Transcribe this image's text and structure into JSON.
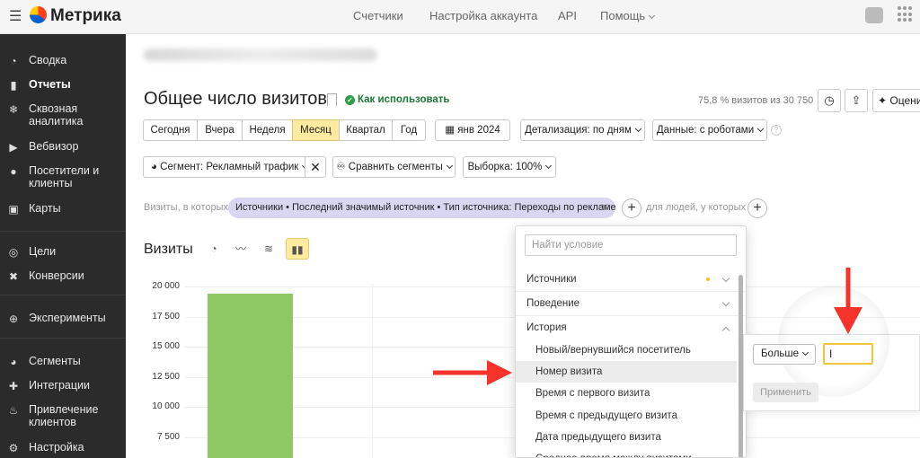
{
  "topbar": {
    "logo": "Метрика",
    "nav": [
      "Счетчики",
      "Настройка аккаунта",
      "API",
      "Помощь"
    ]
  },
  "sidebar": {
    "items": [
      {
        "label": "Сводка",
        "icon": "dashboard-icon"
      },
      {
        "label": "Отчеты",
        "icon": "bar-chart-icon",
        "active": true
      },
      {
        "label": "Сквозная аналитика",
        "icon": "snowflake-icon"
      },
      {
        "label": "Вебвизор",
        "icon": "play-icon"
      },
      {
        "label": "Посетители и клиенты",
        "icon": "person-icon"
      },
      {
        "label": "Карты",
        "icon": "map-icon"
      },
      {
        "label": "Цели",
        "icon": "target-icon"
      },
      {
        "label": "Конверсии",
        "icon": "conversion-icon"
      },
      {
        "label": "Эксперименты",
        "icon": "ab-icon"
      },
      {
        "label": "Сегменты",
        "icon": "pie-icon"
      },
      {
        "label": "Интеграции",
        "icon": "puzzle-icon"
      },
      {
        "label": "Привлечение клиентов",
        "icon": "flame-icon"
      },
      {
        "label": "Настройка",
        "icon": "gear-icon"
      }
    ]
  },
  "header": {
    "title": "Общее число визитов",
    "howto": "Как использовать",
    "sample_info": "75,8 % визитов из 30 750",
    "rate_label": "Оцени"
  },
  "periods": {
    "buttons": [
      "Сегодня",
      "Вчера",
      "Неделя",
      "Месяц",
      "Квартал",
      "Год"
    ],
    "active": "Месяц",
    "date": "янв 2024",
    "detail": "Детализация: по дням",
    "data": "Данные: с роботами"
  },
  "segment": {
    "label": "Сегмент: Рекламный трафик",
    "compare": "Сравнить сегменты",
    "sample": "Выборка: 100%"
  },
  "filter": {
    "prefix": "Визиты, в которых",
    "chip": "Источники • Последний значимый источник • Тип источника: Переходы по рекламе",
    "suffix": "для людей, у которых"
  },
  "chart_data": {
    "type": "bar",
    "title": "Визиты",
    "ylim": [
      0,
      20000
    ],
    "y_ticks": [
      "20 000",
      "17 500",
      "15 000",
      "12 500",
      "10 000",
      "7 500"
    ],
    "categories": [
      ""
    ],
    "values": [
      19400
    ],
    "color": "#8fc966"
  },
  "dropdown": {
    "placeholder": "Найти условие",
    "groups": [
      "Источники",
      "Поведение",
      "История"
    ],
    "items": [
      "Новый/вернувшийся посетитель",
      "Номер визита",
      "Время с первого визита",
      "Время с предыдущего визита",
      "Дата предыдущего визита",
      "Среднее время между визитами"
    ],
    "hovered": "Номер визита"
  },
  "condition": {
    "operator": "Больше",
    "value": "I",
    "apply": "Применить"
  },
  "colors": {
    "accent": "#ffeba0",
    "chip": "#d9d6f2",
    "arrow": "#f5332a",
    "sidebar": "#2b2b2b"
  }
}
